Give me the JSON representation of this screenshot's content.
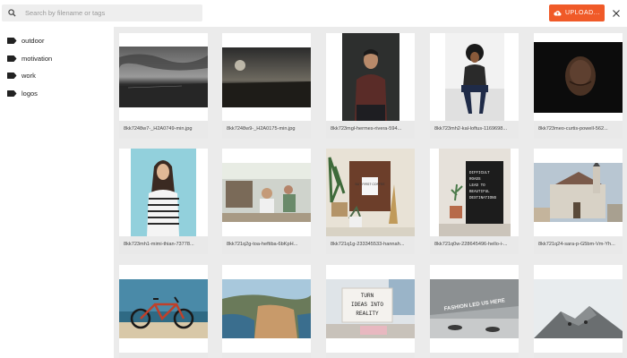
{
  "search": {
    "placeholder": "Search by filename or tags",
    "icon": "search-icon"
  },
  "toolbar": {
    "upload_label": "UPLOAD...",
    "upload_color": "#f05a28",
    "close_icon": "close-icon"
  },
  "sidebar": {
    "tags": [
      {
        "label": "outdoor"
      },
      {
        "label": "motivation"
      },
      {
        "label": "work"
      },
      {
        "label": "logos"
      }
    ]
  },
  "gallery": {
    "items": [
      {
        "filename": "8kk7248w7-_H2A0749-min.jpg"
      },
      {
        "filename": "8kk7248w9-_H2A0175-min.jpg"
      },
      {
        "filename": "8kk723mgl-hermes-rivera-594..."
      },
      {
        "filename": "8kk723mh2-kal-loftus-1169698..."
      },
      {
        "filename": "8kk723meo-curtis-powell-562..."
      },
      {
        "filename": "8kk723mh1-mimi-thian-73778..."
      },
      {
        "filename": "8kk721q2g-toa-heftiba-6bKpH..."
      },
      {
        "filename": "8kk721q1g-233345533-hannah..."
      },
      {
        "filename": "8kk721q0w-228645496-hello-i-..."
      },
      {
        "filename": "8kk721q24-sara-p-G5bm-Vm-Yh..."
      },
      {
        "filename": ""
      },
      {
        "filename": ""
      },
      {
        "filename": ""
      },
      {
        "filename": ""
      },
      {
        "filename": ""
      }
    ],
    "image_text": {
      "sign_lines": [
        "DIFFICULT",
        "ROADS",
        "LEAD TO",
        "BEAUTIFUL",
        "DESTINATIONS"
      ],
      "cafe_cup": "BUT FIRST COFFEE",
      "letterboard_lines": [
        "TURN",
        "IDEAS INTO",
        "REALITY"
      ],
      "sign_text": "FASHION LED US HERE"
    }
  }
}
